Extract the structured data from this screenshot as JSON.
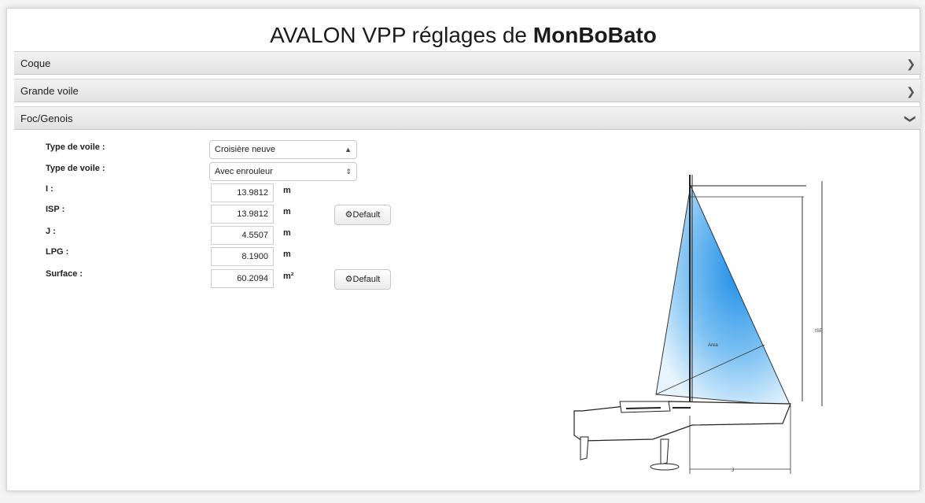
{
  "header": {
    "title_prefix": "AVALON VPP réglages de ",
    "title_bold": "MonBoBato"
  },
  "panels": [
    {
      "label": "Coque",
      "state": "collapsed"
    },
    {
      "label": "Grande voile",
      "state": "collapsed"
    },
    {
      "label": "Foc/Genois",
      "state": "expanded"
    }
  ],
  "form": {
    "sail_type_label_1": "Type de voile :",
    "sail_type_value_1": "Croisière neuve",
    "sail_type_label_2": "Type de voile :",
    "sail_type_value_2": "Avec enrouleur",
    "fields": [
      {
        "label": "I :",
        "value": "13.9812",
        "unit": "m"
      },
      {
        "label": "ISP :",
        "value": "13.9812",
        "unit": "m"
      },
      {
        "label": "J :",
        "value": "4.5507",
        "unit": "m"
      },
      {
        "label": "LPG :",
        "value": "8.1900",
        "unit": "m"
      },
      {
        "label": "Surface :",
        "value": "60.2094",
        "unit": "m²"
      }
    ],
    "default_button": "Default"
  },
  "diagram": {
    "label_area": "Area",
    "label_isp": "ISP",
    "label_j": "J"
  },
  "icons": {
    "collapsed": "chevron-right-icon",
    "expanded": "chevron-down-icon",
    "gear": "gear-icon",
    "select": "updown-arrows-icon"
  }
}
